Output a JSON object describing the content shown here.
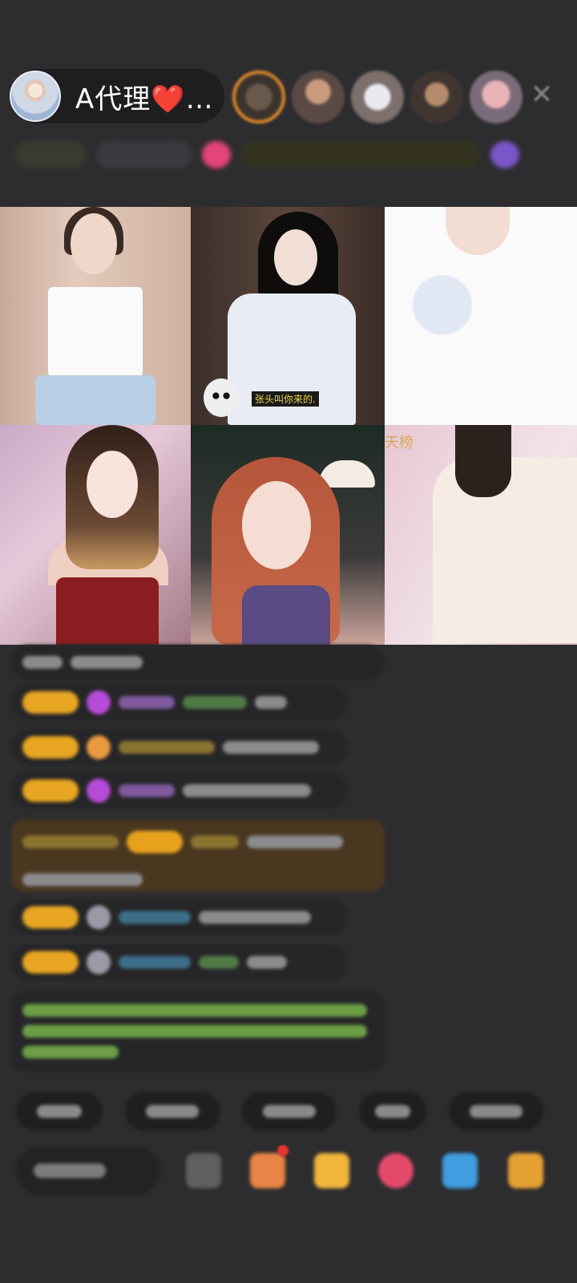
{
  "host": {
    "name": "A代理",
    "heart": "❤️",
    "ellipsis": "…"
  },
  "header": {
    "close_icon": "close-icon"
  },
  "grid": {
    "tile2_caption": "张头叫你来的.",
    "tile6_badge": "天榜"
  }
}
